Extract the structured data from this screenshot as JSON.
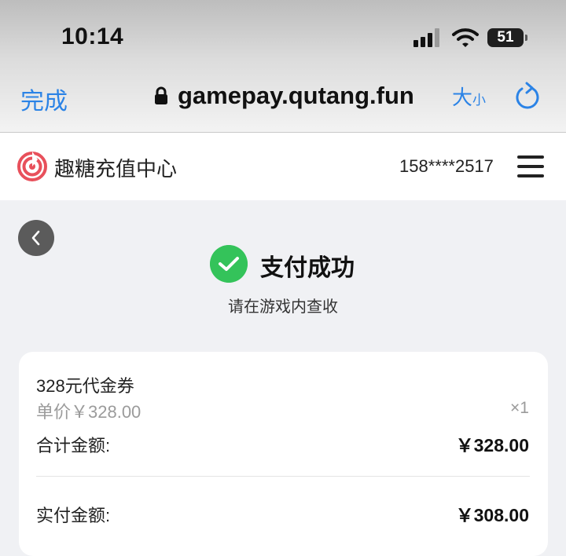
{
  "status_bar": {
    "time": "10:14",
    "battery": "51"
  },
  "browser": {
    "done_label": "完成",
    "url": "gamepay.qutang.fun",
    "text_size_big": "大",
    "text_size_small": "小",
    "accent_color": "#2b83e6"
  },
  "site": {
    "brand": "趣糖充值中心",
    "account": "158****2517",
    "logo_color": "#e8505b"
  },
  "result": {
    "title": "支付成功",
    "subtitle": "请在游戏内查收",
    "status_color": "#34c35a"
  },
  "order": {
    "item_name": "328元代金券",
    "unit_price": "单价￥328.00",
    "quantity": "×1",
    "total_label": "合计金额:",
    "total_value": "￥328.00",
    "paid_label": "实付金额:",
    "paid_value": "￥308.00"
  }
}
